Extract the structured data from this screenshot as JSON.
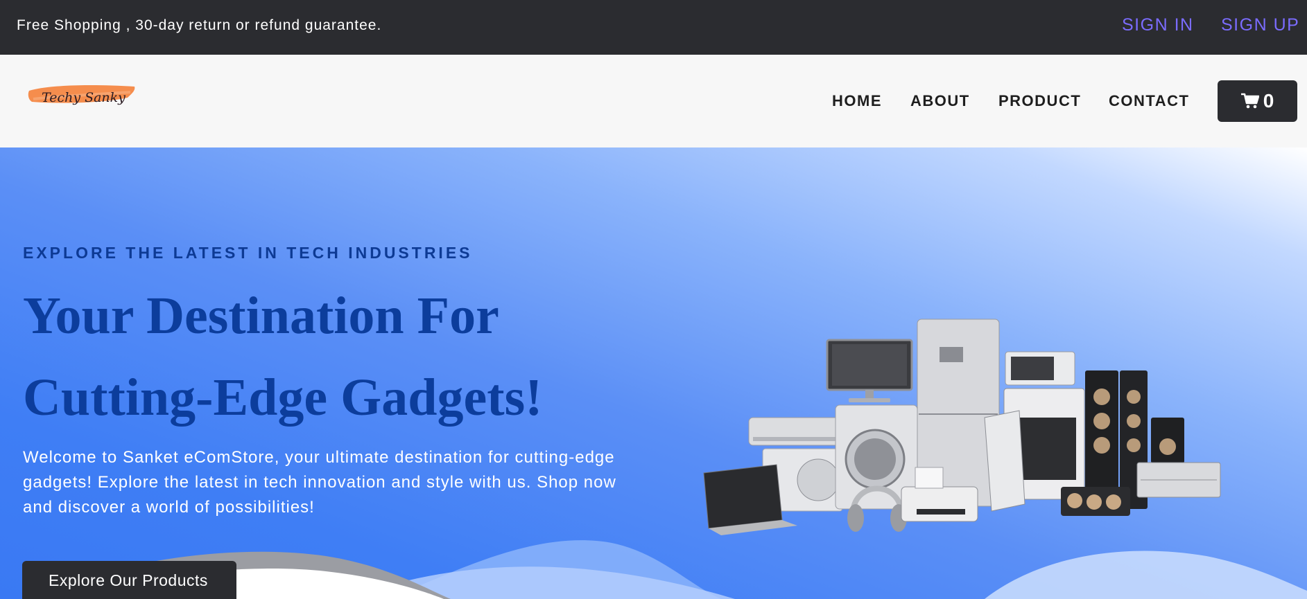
{
  "topbar": {
    "promo_text": "Free Shopping , 30-day return or refund guarantee.",
    "sign_in": "SIGN IN",
    "sign_up": "SIGN UP",
    "link_color": "#7b6cff",
    "background": "#2b2c30"
  },
  "header": {
    "logo_text": "Techy Sanky",
    "nav": {
      "home": "HOME",
      "about": "ABOUT",
      "product": "PRODUCT",
      "contact": "CONTACT"
    },
    "cart": {
      "icon": "shopping-cart-icon",
      "count": "0"
    }
  },
  "hero": {
    "eyebrow": "EXPLORE THE LATEST IN TECH INDUSTRIES",
    "headline_line1": "Your Destination For",
    "headline_line2": "Cutting-Edge Gadgets!",
    "description": "Welcome to Sanket eComStore, your ultimate destination for cutting-edge gadgets! Explore the latest in tech innovation and style with us. Shop now and discover a world of possibilities!",
    "cta_label": "Explore Our Products",
    "image": "home-appliances-image",
    "colors": {
      "headline": "#0c3d9c",
      "gradient_start": "#ffffff",
      "gradient_end": "#3a79f3"
    }
  }
}
